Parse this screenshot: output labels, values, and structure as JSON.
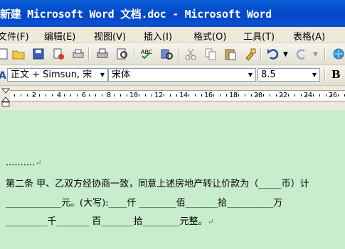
{
  "window": {
    "title": "新建 Microsoft Word 文档.doc - Microsoft Word"
  },
  "menu": {
    "items": [
      "文件(F)",
      "编辑(E)",
      "视图(V)",
      "插入(I)",
      "格式(O)",
      "工具(T)",
      "表格(A)"
    ]
  },
  "toolbar": {
    "icons": [
      "new-icon",
      "open-icon",
      "save-icon",
      "permission-icon",
      "print-preview-icon",
      "print-icon",
      "find-icon",
      "spelling-icon",
      "research-icon",
      "cut-icon",
      "copy-icon",
      "paste-icon",
      "format-painter-icon",
      "undo-icon",
      "redo-icon",
      "hyperlink-icon"
    ]
  },
  "format": {
    "style": "正文 + Simsun, 宋",
    "font": "宋体",
    "size": "8.5",
    "bold_label": "B"
  },
  "ruler": {
    "labels": [
      "2",
      "4",
      "6",
      "8",
      "10",
      "12",
      "14",
      "16",
      "18",
      "20",
      "22",
      "24",
      "26"
    ]
  },
  "document": {
    "lines": [
      "..........",
      "第二条 甲、乙双方经协商一致，同意上述房地产转让价款为（_____币）计",
      "____________元。(大写):____仟 ________佰_______拾__________万",
      "_________千_______ 百_______拾________元整。"
    ],
    "paragraph_mark": "↵"
  },
  "colors": {
    "titlebar": "#0446c6",
    "document_bg": "#c7edcc",
    "chrome": "#ece9d8"
  }
}
